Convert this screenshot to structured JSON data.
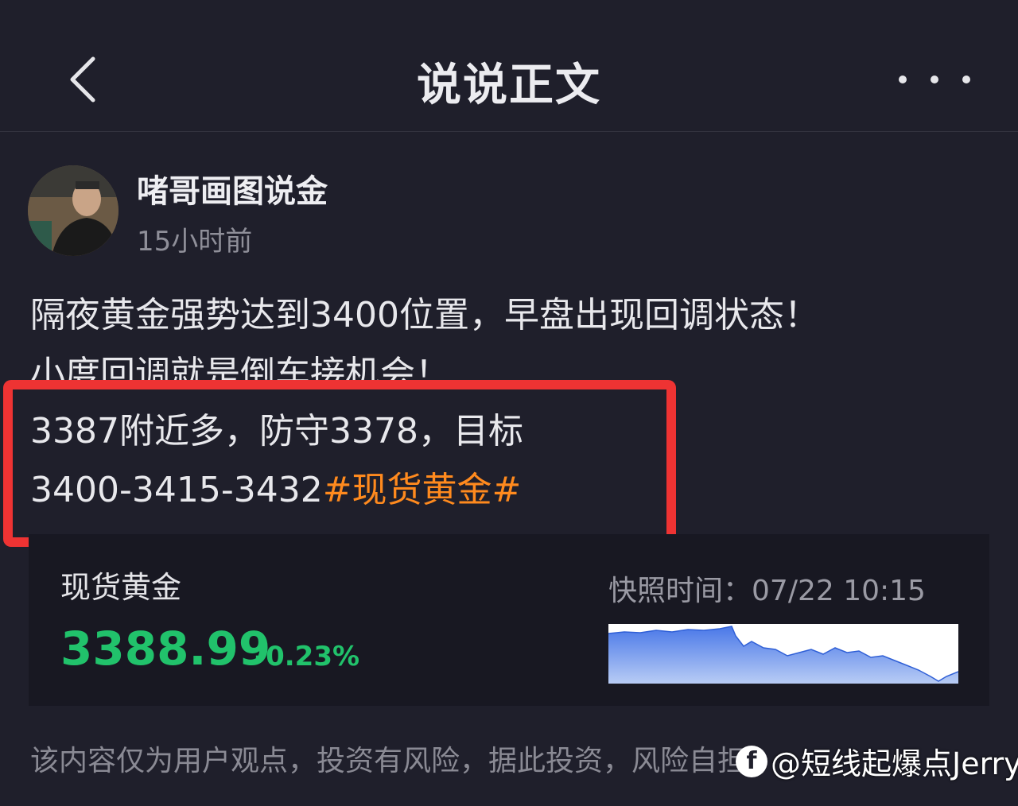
{
  "header": {
    "title": "说说正文",
    "back_icon": "chevron-left-icon",
    "more_icon": "more-horizontal-icon"
  },
  "post": {
    "author": "啫哥画图说金",
    "time": "15小时前",
    "line1": "隔夜黄金强势达到3400位置，早盘出现回调状态！",
    "line2": "小度回调就是倒车接机会！",
    "line3": "3387附近多，防守3378，目标",
    "line4_prefix": "3400-3415-3432",
    "hashtag": "#现货黄金#"
  },
  "quote_card": {
    "name": "现货黄金",
    "price": "3388.99",
    "change": "-0.23%",
    "snapshot_label": "快照时间：",
    "snapshot_time": "07/22 10:15",
    "price_color": "#21c26b"
  },
  "disclaimer": "该内容仅为用户观点，投资有风险，据此投资，风险自担",
  "watermark": {
    "icon": "f",
    "text": "@短线起爆点Jerry"
  },
  "colors": {
    "background": "#1f1f2b",
    "highlight_border": "#ee3333",
    "hashtag": "#ff8a1e",
    "up_down": "#21c26b"
  }
}
